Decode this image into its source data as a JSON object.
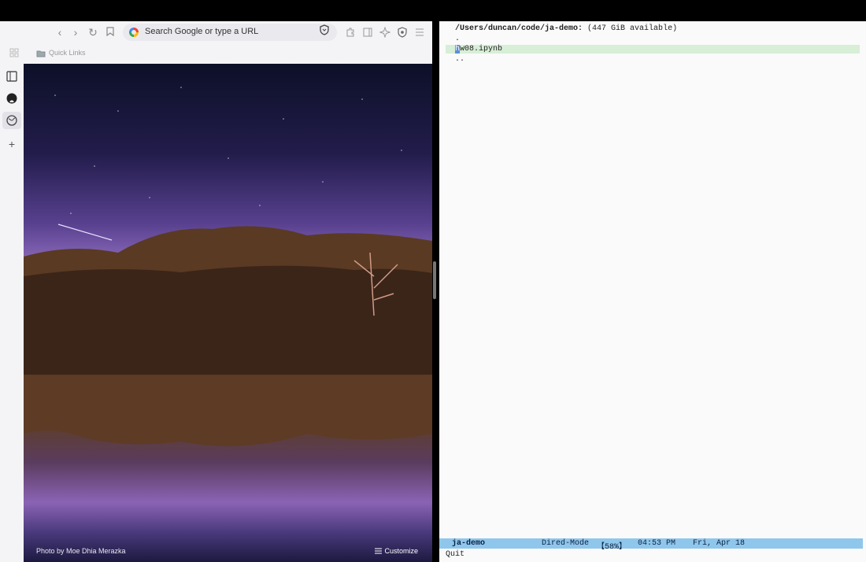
{
  "browser": {
    "url_placeholder": "Search Google or type a URL",
    "bookmarks": {
      "quick_links": "Quick Links"
    },
    "newtab": {
      "photo_credit": "Photo by Moe Dhia Merazka",
      "customize_label": "Customize"
    }
  },
  "emacs": {
    "dir_path": "/Users/duncan/code/ja-demo:",
    "dir_avail": "(447 GiB available)",
    "entries": {
      "dot": ".",
      "file_cursor": "h",
      "file_rest": "w08.ipynb",
      "dotdot": ".."
    },
    "modeline": {
      "buffer": "ja-demo",
      "mode": "Dired-Mode",
      "position": "【58%】",
      "time": "04:53 PM",
      "date": "Fri, Apr 18"
    },
    "minibuffer": "Quit"
  },
  "colors": {
    "modeline_bg": "#8fc6ec",
    "selected_line_bg": "#d7eed7",
    "cursor": "#5a8fd6"
  }
}
